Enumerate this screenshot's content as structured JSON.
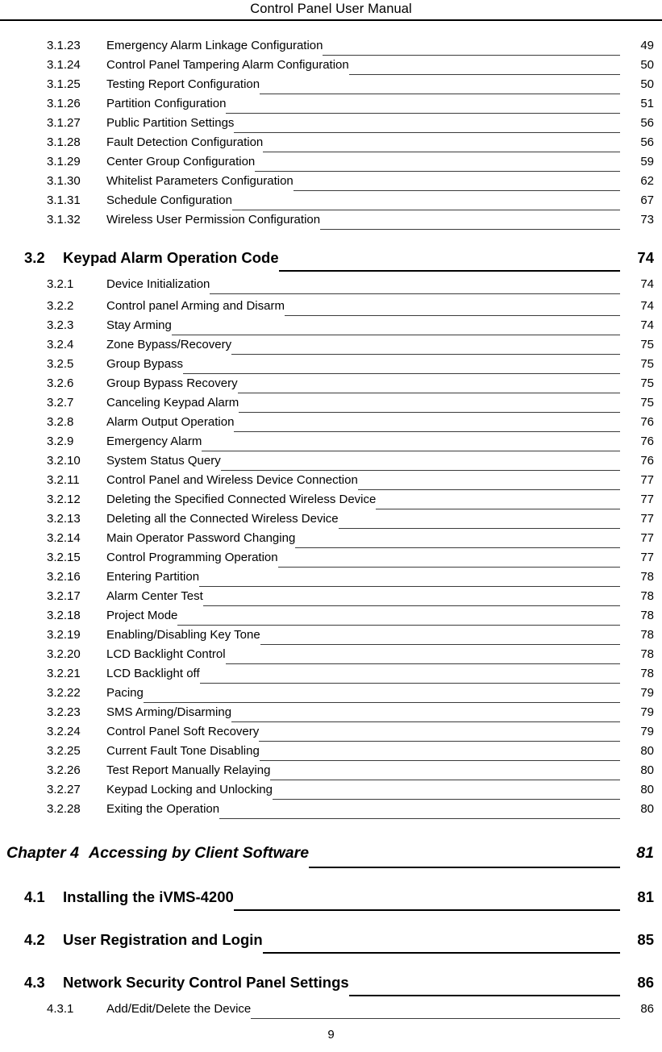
{
  "header": {
    "title": "Control Panel User Manual"
  },
  "footer": {
    "page_number": "9"
  },
  "toc": {
    "entries": [
      {
        "level": 3,
        "number": "3.1.23",
        "label": "Emergency Alarm Linkage Configuration",
        "page": "49"
      },
      {
        "level": 3,
        "number": "3.1.24",
        "label": "Control Panel Tampering Alarm Configuration",
        "page": "50"
      },
      {
        "level": 3,
        "number": "3.1.25",
        "label": "Testing Report Configuration",
        "page": "50"
      },
      {
        "level": 3,
        "number": "3.1.26",
        "label": "Partition Configuration",
        "page": "51"
      },
      {
        "level": 3,
        "number": "3.1.27",
        "label": "Public Partition Settings",
        "page": "56"
      },
      {
        "level": 3,
        "number": "3.1.28",
        "label": "Fault Detection Configuration",
        "page": "56"
      },
      {
        "level": 3,
        "number": "3.1.29",
        "label": "Center Group Configuration",
        "page": "59"
      },
      {
        "level": 3,
        "number": "3.1.30",
        "label": "Whitelist Parameters Configuration",
        "page": "62"
      },
      {
        "level": 3,
        "number": "3.1.31",
        "label": "Schedule Configuration",
        "page": "67"
      },
      {
        "level": 3,
        "number": "3.1.32",
        "label": "Wireless User Permission Configuration",
        "page": "73"
      },
      {
        "level": 2,
        "number": "3.2",
        "label": "Keypad Alarm Operation Code",
        "page": "74"
      },
      {
        "level": 3,
        "number": "3.2.1",
        "label": "Device Initialization",
        "page": "74"
      },
      {
        "level": 3,
        "number": "3.2.2",
        "label": "Control panel Arming and Disarm",
        "page": "74"
      },
      {
        "level": 3,
        "number": "3.2.3",
        "label": "Stay Arming",
        "page": "74"
      },
      {
        "level": 3,
        "number": "3.2.4",
        "label": "Zone Bypass/Recovery",
        "page": "75"
      },
      {
        "level": 3,
        "number": "3.2.5",
        "label": "Group Bypass",
        "page": "75"
      },
      {
        "level": 3,
        "number": "3.2.6",
        "label": "Group Bypass Recovery",
        "page": "75"
      },
      {
        "level": 3,
        "number": "3.2.7",
        "label": "Canceling Keypad Alarm",
        "page": "75"
      },
      {
        "level": 3,
        "number": "3.2.8",
        "label": "Alarm Output Operation",
        "page": "76"
      },
      {
        "level": 3,
        "number": "3.2.9",
        "label": "Emergency Alarm",
        "page": "76"
      },
      {
        "level": 3,
        "number": "3.2.10",
        "label": "System Status Query",
        "page": "76"
      },
      {
        "level": 3,
        "number": "3.2.11",
        "label": "Control Panel and Wireless Device Connection",
        "page": "77"
      },
      {
        "level": 3,
        "number": "3.2.12",
        "label": "Deleting the Specified Connected Wireless Device",
        "page": "77"
      },
      {
        "level": 3,
        "number": "3.2.13",
        "label": "Deleting all the Connected Wireless Device",
        "page": "77"
      },
      {
        "level": 3,
        "number": "3.2.14",
        "label": "Main Operator Password Changing",
        "page": "77"
      },
      {
        "level": 3,
        "number": "3.2.15",
        "label": "Control Programming Operation",
        "page": "77"
      },
      {
        "level": 3,
        "number": "3.2.16",
        "label": "Entering Partition",
        "page": "78"
      },
      {
        "level": 3,
        "number": "3.2.17",
        "label": "Alarm Center Test",
        "page": "78"
      },
      {
        "level": 3,
        "number": "3.2.18",
        "label": "Project Mode",
        "page": "78"
      },
      {
        "level": 3,
        "number": "3.2.19",
        "label": "Enabling/Disabling Key Tone",
        "page": "78"
      },
      {
        "level": 3,
        "number": "3.2.20",
        "label": "LCD Backlight Control",
        "page": "78"
      },
      {
        "level": 3,
        "number": "3.2.21",
        "label": "LCD Backlight off",
        "page": "78"
      },
      {
        "level": 3,
        "number": "3.2.22",
        "label": "Pacing",
        "page": "79"
      },
      {
        "level": 3,
        "number": "3.2.23",
        "label": "SMS Arming/Disarming",
        "page": "79"
      },
      {
        "level": 3,
        "number": "3.2.24",
        "label": "Control Panel Soft Recovery",
        "page": "79"
      },
      {
        "level": 3,
        "number": "3.2.25",
        "label": "Current Fault Tone Disabling",
        "page": "80"
      },
      {
        "level": 3,
        "number": "3.2.26",
        "label": "Test Report Manually Relaying",
        "page": "80"
      },
      {
        "level": 3,
        "number": "3.2.27",
        "label": "Keypad Locking and Unlocking",
        "page": "80"
      },
      {
        "level": 3,
        "number": "3.2.28",
        "label": "Exiting the Operation",
        "page": "80"
      },
      {
        "level": 1,
        "number": "Chapter 4",
        "label": "Accessing by Client Software",
        "page": "81"
      },
      {
        "level": 2,
        "number": "4.1",
        "label": "Installing the iVMS-4200",
        "page": "81"
      },
      {
        "level": 2,
        "number": "4.2",
        "label": "User Registration and Login",
        "page": "85"
      },
      {
        "level": 2,
        "number": "4.3",
        "label": "Network Security Control Panel Settings",
        "page": "86"
      },
      {
        "level": 3,
        "number": "4.3.1",
        "label": "Add/Edit/Delete the Device",
        "page": "86"
      }
    ]
  }
}
